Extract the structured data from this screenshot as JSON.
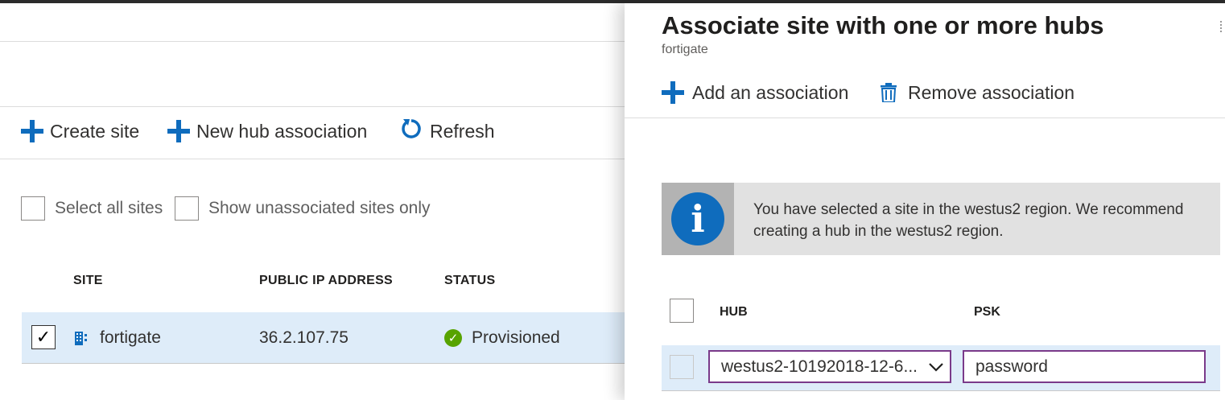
{
  "left": {
    "commands": {
      "create_site": "Create site",
      "new_hub_association": "New hub association",
      "refresh": "Refresh"
    },
    "filters": {
      "select_all": "Select all sites",
      "show_unassociated": "Show unassociated sites only"
    },
    "table": {
      "columns": [
        "SITE",
        "PUBLIC IP ADDRESS",
        "STATUS"
      ],
      "rows": [
        {
          "site": "fortigate",
          "public_ip": "36.2.107.75",
          "status": "Provisioned",
          "checked": true
        }
      ]
    }
  },
  "panel": {
    "title": "Associate site with one or more hubs",
    "subtitle": "fortigate",
    "commands": {
      "add": "Add an association",
      "remove": "Remove association"
    },
    "info": "You have selected a site in the westus2 region. We recommend creating a hub in the westus2 region.",
    "table": {
      "columns": [
        "HUB",
        "PSK"
      ],
      "rows": [
        {
          "hub": "westus2-10192018-12-6...",
          "psk": "password"
        }
      ]
    }
  },
  "colors": {
    "accent": "#0f6cbd",
    "selected_row": "#deecf9",
    "success": "#57a300",
    "field_border": "#7a3a8a"
  },
  "icons": [
    "plus-icon",
    "refresh-icon",
    "checkbox",
    "building-icon",
    "check-circle-icon",
    "trash-icon",
    "info-icon",
    "chevron-down-icon"
  ]
}
